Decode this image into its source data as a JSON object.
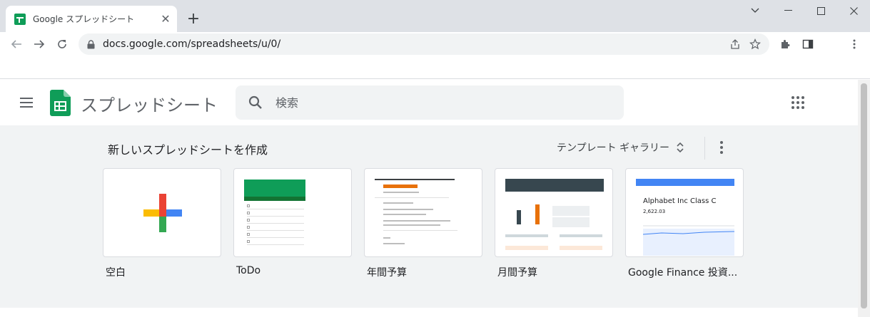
{
  "browser": {
    "tab_title": "Google スプレッドシート",
    "url": "docs.google.com/spreadsheets/u/0/"
  },
  "app": {
    "name": "スプレッドシート",
    "search_placeholder": "検索"
  },
  "templates": {
    "section_title": "新しいスプレッドシートを作成",
    "gallery_label": "テンプレート ギャラリー",
    "items": [
      {
        "label": "空白"
      },
      {
        "label": "ToDo"
      },
      {
        "label": "年間予算"
      },
      {
        "label": "月間予算"
      },
      {
        "label": "Google Finance 投資..."
      }
    ],
    "finance_thumb": {
      "title": "Alphabet Inc Class C",
      "price": "2,622.03"
    }
  },
  "colors": {
    "sheets_green": "#0f9d58",
    "tab_strip": "#dee1e6",
    "template_bg": "#f1f3f4",
    "plus_red": "#ea4335",
    "plus_blue": "#4285f4",
    "plus_yellow": "#fbbc04",
    "plus_green": "#34a853"
  }
}
